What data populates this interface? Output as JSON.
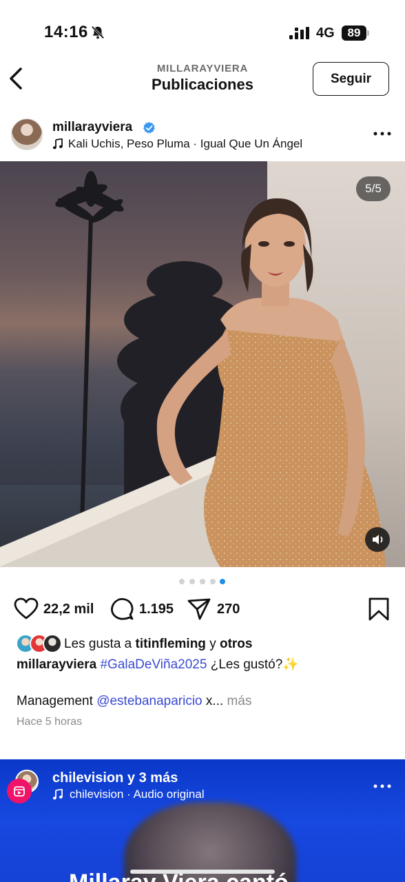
{
  "status_bar": {
    "time": "14:16",
    "network": "4G",
    "battery": "89",
    "icons": [
      "bell-slash-icon",
      "signal-icon",
      "battery-icon"
    ]
  },
  "nav": {
    "username": "MILLARAYVIERA",
    "title": "Publicaciones",
    "follow_label": "Seguir"
  },
  "post": {
    "username": "millarayviera",
    "verified": true,
    "song": "Kali Uchis, Peso Pluma · Igual Que Un Ángel",
    "media_counter": "5/5",
    "carousel_total": 5,
    "carousel_active": 5,
    "likes_count": "22,2 mil",
    "comments_count": "1.195",
    "shares_count": "270",
    "liked_by_prefix": "Les gusta a ",
    "liked_by_user": "titinfleming",
    "liked_by_mid": " y ",
    "liked_by_others": "otros",
    "caption_user": "millarayviera",
    "caption_hashtag": "#GalaDeViña2025",
    "caption_text": " ¿Les gustó?",
    "caption_emoji": "✨",
    "management_prefix": "Management ",
    "management_mention": "@estebanaparicio",
    "management_suffix": " x...",
    "more_label": " más",
    "time_ago": "Hace 5 horas"
  },
  "next_post": {
    "username": "chilevision",
    "others": " y 3 más",
    "audio": "chilevision · Audio original",
    "headline": "Millaray Viera cantó"
  },
  "colors": {
    "link_blue": "#3b4ad1",
    "verified_blue": "#3897f0",
    "active_dot": "#1e8fe8",
    "next_post_bg": "#1642d6",
    "reel_pink": "#f0136a"
  }
}
